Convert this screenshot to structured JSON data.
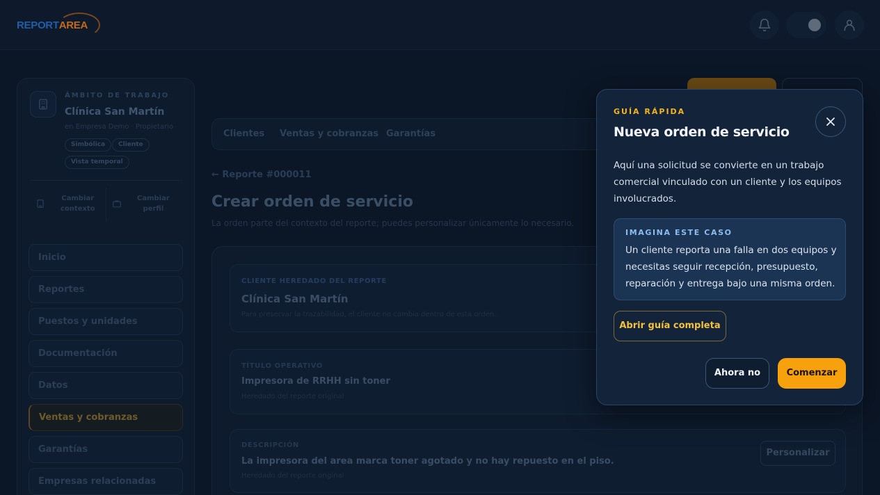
{
  "header": {
    "logo_report": "REPORT",
    "logo_area": "AREA",
    "notifications_icon": "bell-icon",
    "theme_icon": "moon-icon",
    "user_icon": "user-icon"
  },
  "sidebar": {
    "workspace_kicker": "ÁMBITO DE TRABAJO",
    "workspace_name": "Clínica San Martín",
    "workspace_sub": "en Empresa Demo · Propietario",
    "chips": [
      "Simbólica",
      "Cliente",
      "Vista temporal"
    ],
    "switch_context": [
      "Cambiar",
      "contexto"
    ],
    "switch_profile": [
      "Cambiar",
      "perfil"
    ],
    "items": [
      {
        "label": "Inicio"
      },
      {
        "label": "Reportes"
      },
      {
        "label": "Puestos y unidades"
      },
      {
        "label": "Documentación"
      },
      {
        "label": "Datos"
      },
      {
        "label": "Ventas y cobranzas",
        "active": true
      },
      {
        "label": "Garantías"
      },
      {
        "label": "Empresas relacionadas"
      }
    ]
  },
  "main": {
    "tabs": [
      {
        "label": "Clientes"
      },
      {
        "label": "Ventas y cobranzas"
      },
      {
        "label": "Garantías"
      }
    ],
    "back_link": "← Reporte #000011",
    "title": "Crear orden de servicio",
    "subtitle": "La orden parte del contexto del reporte; puedes personalizar únicamente lo necesario.",
    "client_card": {
      "kicker": "CLIENTE HEREDADO DEL REPORTE",
      "title": "Clínica San Martín",
      "note": "Para preservar la trazabilidad, el cliente no cambia dentro de esta orden."
    },
    "title_card": {
      "kicker": "TÍTULO OPERATIVO",
      "title": "Impresora de RRHH sin toner",
      "note": "Heredado del reporte original"
    },
    "desc_card": {
      "kicker": "DESCRIPCIÓN",
      "title": "La impresora del area marca toner agotado y no hay repuesto en el piso.",
      "note": "Heredado del reporte original",
      "button": "Personalizar"
    }
  },
  "modal": {
    "kicker": "GUÍA RÁPIDA",
    "title": "Nueva orden de servicio",
    "close_icon": "close-icon",
    "body": "Aquí una solicitud se convierte en un trabajo comercial vinculado con un cliente y los equipos involucrados.",
    "case_kicker": "IMAGINA ESTE CASO",
    "case_text": "Un cliente reporta una falla en dos equipos y necesitas seguir recepción, presupuesto, reparación y entrega bajo una misma orden.",
    "guide_button": "Abrir guía completa",
    "later_button": "Ahora no",
    "start_button": "Comenzar"
  },
  "colors": {
    "background": "#0b1626",
    "accent_orange": "#f7a20c",
    "accent_yellow": "#f3b41c",
    "modal_bg": "#13233a"
  }
}
